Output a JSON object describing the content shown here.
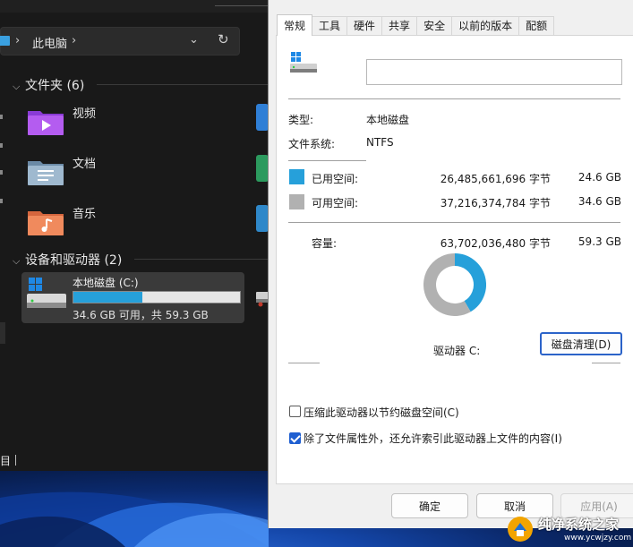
{
  "explorer": {
    "breadcrumb": {
      "current": "此电脑",
      "separator": "›"
    },
    "groups": [
      {
        "label": "文件夹 (6)"
      },
      {
        "label": "设备和驱动器 (2)"
      }
    ],
    "folders": [
      {
        "label": "视频",
        "icon": "videos-folder-icon"
      },
      {
        "label": "文档",
        "icon": "documents-folder-icon"
      },
      {
        "label": "音乐",
        "icon": "music-folder-icon"
      }
    ],
    "drive": {
      "label": "本地磁盘 (C:)",
      "free_text": "34.6 GB 可用，共 59.3 GB",
      "used_fraction": 0.415
    },
    "status_left": "目"
  },
  "dialog": {
    "tabs": [
      "常规",
      "工具",
      "硬件",
      "共享",
      "安全",
      "以前的版本",
      "配额"
    ],
    "active_tab": "常规",
    "name_value": "",
    "type_label": "类型:",
    "type_value": "本地磁盘",
    "fs_label": "文件系统:",
    "fs_value": "NTFS",
    "used": {
      "label": "已用空间:",
      "bytes": "26,485,661,696 字节",
      "size": "24.6 GB",
      "color": "#26a0da"
    },
    "free": {
      "label": "可用空间:",
      "bytes": "37,216,374,784 字节",
      "size": "34.6 GB",
      "color": "#b1b1b1"
    },
    "capacity": {
      "label": "容量:",
      "bytes": "63,702,036,480 字节",
      "size": "59.3 GB"
    },
    "drive_label": "驱动器 C:",
    "cleanup_button": "磁盘清理(D)",
    "compress_checkbox": {
      "label": "压缩此驱动器以节约磁盘空间(C)",
      "checked": false
    },
    "index_checkbox": {
      "label": "除了文件属性外，还允许索引此驱动器上文件的内容(I)",
      "checked": true
    },
    "buttons": {
      "ok": "确定",
      "cancel": "取消",
      "apply": "应用(A)"
    }
  },
  "watermark": {
    "text": "纯净系统之家",
    "url": "www.ycwjzy.com"
  },
  "chart_data": {
    "type": "pie",
    "categories": [
      "已用空间",
      "可用空间"
    ],
    "values": [
      26485661696,
      37216374784
    ],
    "colors": [
      "#26a0da",
      "#b1b1b1"
    ],
    "title": "驱动器 C:"
  }
}
